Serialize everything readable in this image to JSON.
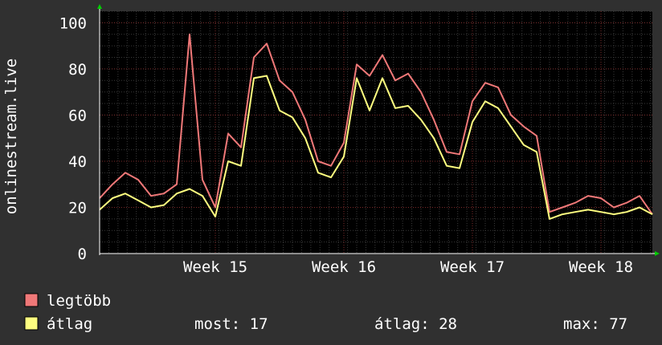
{
  "colors": {
    "background": "#303030",
    "plot_background": "#000000",
    "grid_minor": "#3a3a3a",
    "grid_major": "#7a2a2a",
    "axis": "#ffffff",
    "arrow": "#00cc00",
    "series_max": "#f07878",
    "series_avg": "#ffff80"
  },
  "chart_data": {
    "type": "line",
    "ylabel": "onlinestream.live",
    "ylim": [
      0,
      105
    ],
    "y_ticks": [
      0,
      20,
      40,
      60,
      80,
      100
    ],
    "x_range": [
      14.1,
      18.4
    ],
    "x_ticks": [
      {
        "value": 15,
        "label": "Week 15"
      },
      {
        "value": 16,
        "label": "Week 16"
      },
      {
        "value": 17,
        "label": "Week 17"
      },
      {
        "value": 18,
        "label": "Week 18"
      }
    ],
    "grid": true,
    "series": [
      {
        "name": "legtöbb",
        "color": "#f07878",
        "x": [
          14.1,
          14.2,
          14.3,
          14.4,
          14.5,
          14.6,
          14.7,
          14.8,
          14.9,
          15.0,
          15.1,
          15.2,
          15.3,
          15.4,
          15.5,
          15.6,
          15.7,
          15.8,
          15.9,
          16.0,
          16.1,
          16.2,
          16.3,
          16.4,
          16.5,
          16.6,
          16.7,
          16.8,
          16.9,
          17.0,
          17.1,
          17.2,
          17.3,
          17.4,
          17.5,
          17.6,
          17.7,
          17.8,
          17.9,
          18.0,
          18.1,
          18.2,
          18.3,
          18.4
        ],
        "values": [
          24,
          30,
          35,
          32,
          25,
          26,
          30,
          95,
          32,
          20,
          52,
          46,
          85,
          91,
          75,
          70,
          58,
          40,
          38,
          48,
          82,
          77,
          86,
          75,
          78,
          70,
          58,
          44,
          43,
          66,
          74,
          72,
          60,
          55,
          51,
          18,
          20,
          22,
          25,
          24,
          20,
          22,
          25,
          17
        ]
      },
      {
        "name": "átlag",
        "color": "#ffff80",
        "x": [
          14.1,
          14.2,
          14.3,
          14.4,
          14.5,
          14.6,
          14.7,
          14.8,
          14.9,
          15.0,
          15.1,
          15.2,
          15.3,
          15.4,
          15.5,
          15.6,
          15.7,
          15.8,
          15.9,
          16.0,
          16.1,
          16.2,
          16.3,
          16.4,
          16.5,
          16.6,
          16.7,
          16.8,
          16.9,
          17.0,
          17.1,
          17.2,
          17.3,
          17.4,
          17.5,
          17.6,
          17.7,
          17.8,
          17.9,
          18.0,
          18.1,
          18.2,
          18.3,
          18.4
        ],
        "values": [
          19,
          24,
          26,
          23,
          20,
          21,
          26,
          28,
          25,
          16,
          40,
          38,
          76,
          77,
          62,
          59,
          50,
          35,
          33,
          42,
          76,
          62,
          76,
          63,
          64,
          58,
          50,
          38,
          37,
          57,
          66,
          63,
          55,
          47,
          44,
          15,
          17,
          18,
          19,
          18,
          17,
          18,
          20,
          17
        ]
      }
    ]
  },
  "legend": {
    "items": [
      {
        "label": "legtöbb",
        "color": "#f07878"
      },
      {
        "label": "átlag",
        "color": "#ffff80"
      }
    ],
    "stats": {
      "most": "most: 17",
      "atlag": "átlag: 28",
      "max": "max: 77"
    }
  }
}
